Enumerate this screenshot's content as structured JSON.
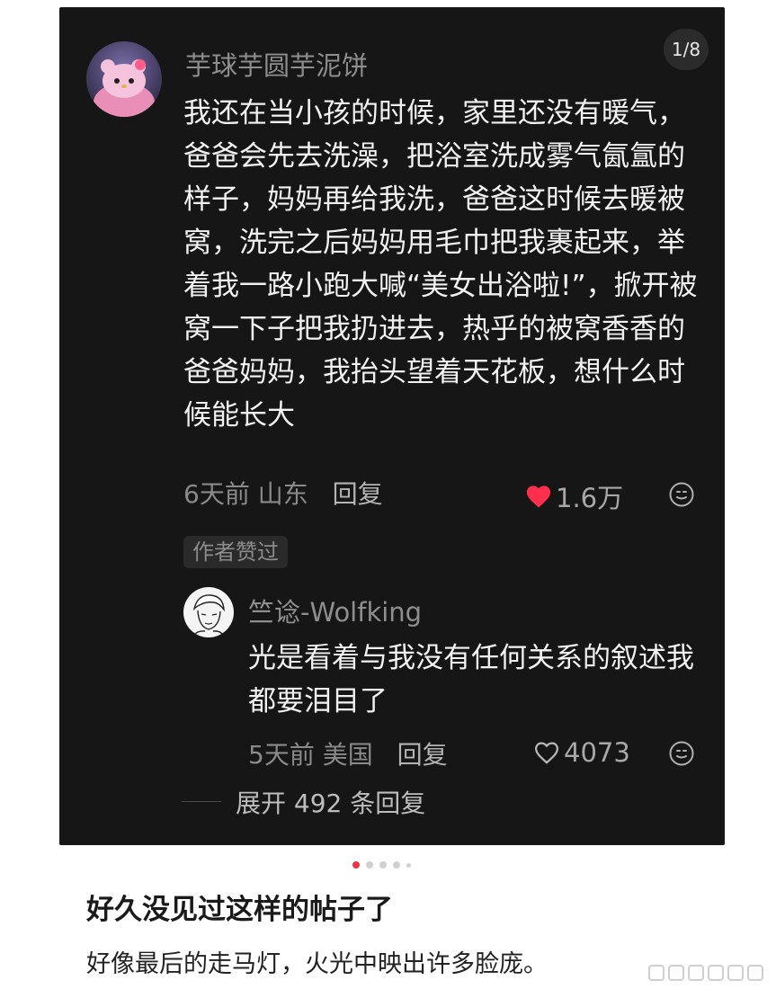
{
  "page_counter": "1/8",
  "comment": {
    "username": "芋球芋圆芋泥饼",
    "text": "我还在当小孩的时候，家里还没有暖气，爸爸会先去洗澡，把浴室洗成雾气氤氲的样子，妈妈再给我洗，爸爸这时候去暖被窝，洗完之后妈妈用毛巾把我裹起来，举着我一路小跑大喊“美女出浴啦!”，掀开被窝一下子把我扔进去，热乎的被窝香香的爸爸妈妈，我抬头望着天花板，想什么时候能长大",
    "time": "6天前",
    "location": "山东",
    "reply_label": "回复",
    "likes": "1.6万",
    "author_badge": "作者赞过",
    "like_color": "#ff2e4d"
  },
  "reply": {
    "username": "竺谂-Wolfking",
    "text": "光是看着与我没有任何关系的叙述我都要泪目了",
    "time": "5天前",
    "location": "美国",
    "reply_label": "回复",
    "likes": "4073"
  },
  "expand_replies": "展开 492 条回复",
  "carousel": {
    "count": 5,
    "active_index": 0,
    "active_color": "#ee3344"
  },
  "post": {
    "title": "好久没见过这样的帖子了",
    "body": "好像最后的走马灯，火光中映出许多脸庞。"
  }
}
